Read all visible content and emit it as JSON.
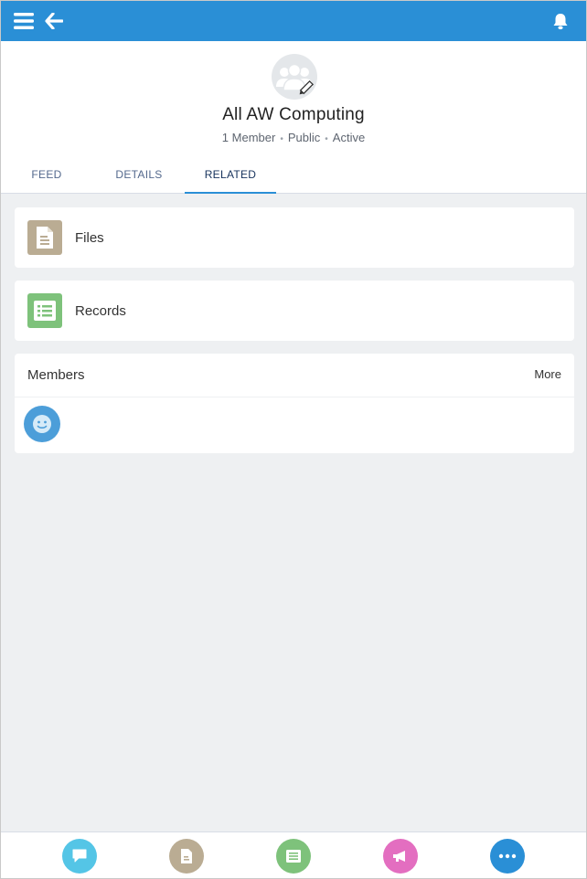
{
  "topbar": {
    "menu_icon": "hamburger-menu-icon",
    "back_icon": "back-arrow-icon",
    "notification_icon": "bell-icon",
    "color": "#2a8fd6"
  },
  "group": {
    "title": "All AW Computing",
    "members": "1 Member",
    "visibility": "Public",
    "status": "Active",
    "avatar_icon": "group-icon"
  },
  "tabs": [
    {
      "label": "FEED"
    },
    {
      "label": "DETAILS"
    },
    {
      "label": "RELATED",
      "active": true
    }
  ],
  "related": {
    "files": {
      "label": "Files",
      "icon": "document-icon",
      "color": "#baac93"
    },
    "records": {
      "label": "Records",
      "icon": "list-record-icon",
      "color": "#7ec27b"
    }
  },
  "members_card": {
    "title": "Members",
    "more_label": "More",
    "member_icon": "user-avatar-icon",
    "member_color": "#4c9ed9"
  },
  "actions": [
    {
      "name": "post",
      "icon": "chat-bubble-icon",
      "color": "#54c5e6"
    },
    {
      "name": "file",
      "icon": "file-icon",
      "color": "#baac93"
    },
    {
      "name": "record",
      "icon": "record-icon",
      "color": "#7ec27b"
    },
    {
      "name": "announcement",
      "icon": "megaphone-icon",
      "color": "#e36ec0"
    },
    {
      "name": "more",
      "icon": "more-dots-icon",
      "color": "#2a8fd6"
    }
  ]
}
